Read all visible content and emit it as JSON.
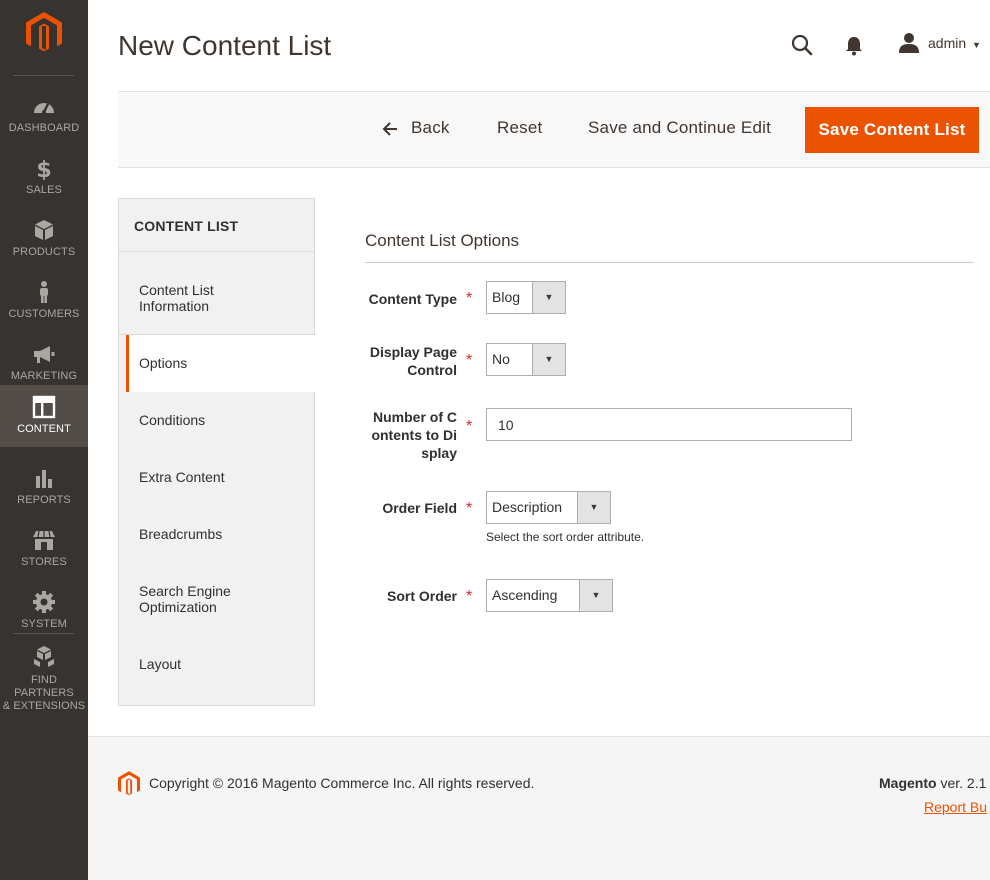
{
  "sidebar": {
    "items": [
      {
        "label": "DASHBOARD",
        "icon": "dashboard-icon"
      },
      {
        "label": "SALES",
        "icon": "dollar-icon"
      },
      {
        "label": "PRODUCTS",
        "icon": "box-icon"
      },
      {
        "label": "CUSTOMERS",
        "icon": "person-icon"
      },
      {
        "label": "MARKETING",
        "icon": "megaphone-icon"
      },
      {
        "label": "CONTENT",
        "icon": "layout-icon",
        "active": true
      },
      {
        "label": "REPORTS",
        "icon": "bar-chart-icon"
      },
      {
        "label": "STORES",
        "icon": "store-icon"
      },
      {
        "label": "SYSTEM",
        "icon": "gear-icon"
      }
    ],
    "partners": {
      "line1": "FIND PARTNERS",
      "line2": "& EXTENSIONS",
      "icon": "cubes-icon"
    }
  },
  "header": {
    "title": "New Content List",
    "user": "admin"
  },
  "actions": {
    "back": "Back",
    "reset": "Reset",
    "save_continue": "Save and Continue Edit",
    "save": "Save Content List"
  },
  "tabs": {
    "title": "CONTENT LIST",
    "items": [
      {
        "line1": "Content List",
        "line2": "Information"
      },
      {
        "line1": "Options",
        "active": true
      },
      {
        "line1": "Conditions"
      },
      {
        "line1": "Extra Content"
      },
      {
        "line1": "Breadcrumbs"
      },
      {
        "line1": "Search Engine",
        "line2": "Optimization"
      },
      {
        "line1": "Layout"
      }
    ]
  },
  "form": {
    "section_title": "Content List Options",
    "required_mark": "*",
    "content_type": {
      "label": "Content Type",
      "value": "Blog"
    },
    "display_page_control": {
      "label1": "Display Page",
      "label2": "Control",
      "value": "No"
    },
    "number_of_contents": {
      "label1": "Number of C",
      "label2": "ontents to Di",
      "label3": "splay",
      "value": "10"
    },
    "order_field": {
      "label": "Order Field",
      "value": "Description",
      "note": "Select the sort order attribute."
    },
    "sort_order": {
      "label": "Sort Order",
      "value": "Ascending"
    }
  },
  "footer": {
    "copyright": "Copyright © 2016 Magento Commerce Inc. All rights reserved.",
    "brand": "Magento",
    "version": "ver. 2.1",
    "report": "Report Bu"
  },
  "colors": {
    "accent": "#eb5202",
    "sidebar_bg": "#373330",
    "sidebar_active": "#524d49"
  }
}
